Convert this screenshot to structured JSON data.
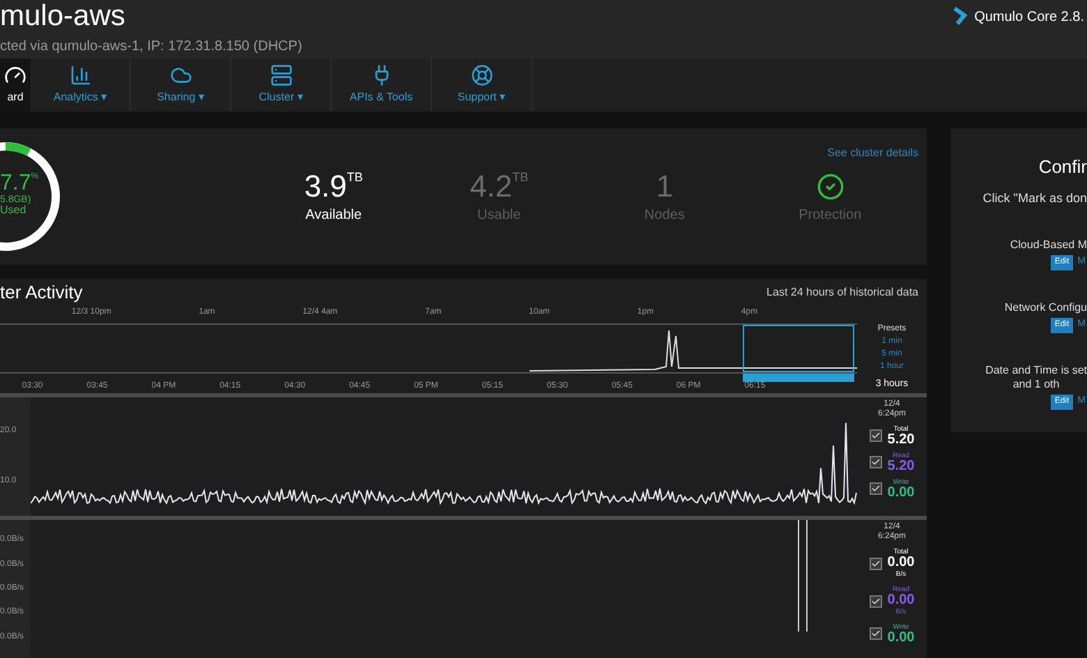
{
  "header": {
    "title": "mulo-aws",
    "subtitle": "cted via qumulo-aws-1, IP: 172.31.8.150 (DHCP)",
    "product": "Qumulo Core 2.8."
  },
  "nav": [
    {
      "label": "ard",
      "selected": true
    },
    {
      "label": "Analytics ▾",
      "selected": false
    },
    {
      "label": "Sharing ▾",
      "selected": false
    },
    {
      "label": "Cluster ▾",
      "selected": false
    },
    {
      "label": "APIs & Tools",
      "selected": false
    },
    {
      "label": "Support ▾",
      "selected": false
    }
  ],
  "capacity": {
    "used_percent": "7.7",
    "percent_sign": "%",
    "used_size": "5.8GB)",
    "used_label": "Used",
    "level": 0.077,
    "link": "See cluster details",
    "stats": [
      {
        "kind": "value",
        "value": "3.9",
        "unit": "TB",
        "label": "Available",
        "dim": false
      },
      {
        "kind": "value",
        "value": "4.2",
        "unit": "TB",
        "label": "Usable",
        "dim": true
      },
      {
        "kind": "value",
        "value": "1",
        "label": "Nodes",
        "dim": true
      },
      {
        "kind": "status",
        "label": "Protection",
        "dim": true
      }
    ]
  },
  "activity": {
    "title": "ter Activity",
    "subtitle": "Last 24 hours of historical data",
    "overview_ticks": [
      "12/3 10pm",
      "1am",
      "12/4 4am",
      "7am",
      "10am",
      "1pm",
      "4pm"
    ],
    "presets_title": "Presets",
    "presets": [
      {
        "label": "1 min",
        "selected": false
      },
      {
        "label": "5 min",
        "selected": false
      },
      {
        "label": "1 hour",
        "selected": false
      },
      {
        "label": "3 hours",
        "selected": true
      }
    ],
    "time_ticks": [
      "03:30",
      "03:45",
      "04 PM",
      "04:15",
      "04:30",
      "04:45",
      "05 PM",
      "05:15",
      "05:30",
      "05:45",
      "06 PM",
      "06:15"
    ],
    "charts": [
      {
        "yticks": [
          "20.0",
          "10.0"
        ],
        "time": [
          "12/4",
          "6:24pm"
        ],
        "legend": [
          {
            "label": "Total",
            "value": "5.20",
            "color": "#ffffff",
            "checked": true
          },
          {
            "label": "Read",
            "value": "5.20",
            "color": "#8a5cf0",
            "checked": true
          },
          {
            "label": "Write",
            "value": "0.00",
            "color": "#2bbf8a",
            "checked": true
          }
        ]
      },
      {
        "yticks": [
          "0.0B/s",
          "0.0B/s",
          "0.0B/s",
          "0.0B/s",
          "0.0B/s"
        ],
        "time": [
          "12/4",
          "6:24pm"
        ],
        "legend": [
          {
            "label": "Total",
            "value": "0.00",
            "unit": "B/s",
            "color": "#ffffff",
            "checked": true
          },
          {
            "label": "Read",
            "value": "0.00",
            "unit": "B/s",
            "color": "#8a5cf0",
            "checked": true
          },
          {
            "label": "Write",
            "value": "0.00",
            "color": "#2bbf8a",
            "checked": true
          }
        ]
      }
    ]
  },
  "checklist": {
    "title": "Confir",
    "intro": "Click \"Mark as don",
    "items": [
      {
        "text": "Cloud-Based M",
        "button": "Edit",
        "link": "M"
      },
      {
        "text": "Network Configu",
        "button": "Edit",
        "link": "M"
      },
      {
        "text": "Date and Time is set\nand 1 oth",
        "button": "Edit",
        "link": "M"
      }
    ]
  }
}
